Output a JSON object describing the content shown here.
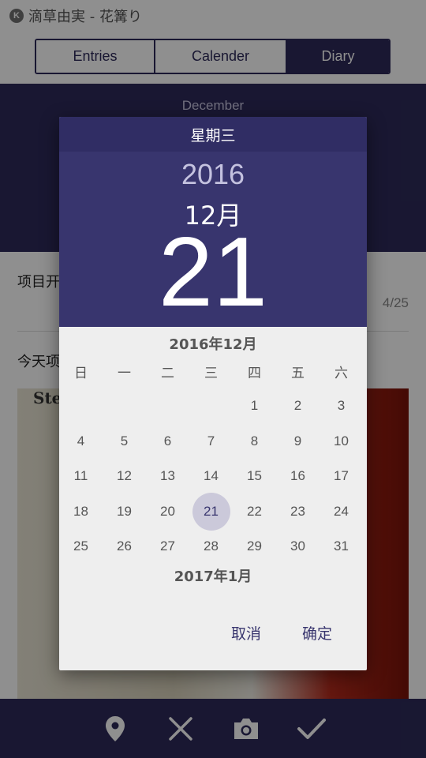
{
  "app": {
    "title": "滴草由実 - 花篝り",
    "logo_letter": "K",
    "tabs": [
      {
        "label": "Entries",
        "active": false
      },
      {
        "label": "Calender",
        "active": false
      },
      {
        "label": "Diary",
        "active": true
      }
    ],
    "hero_month": "December",
    "row1_label": "项目开",
    "row1_count": "4/25",
    "row2_label": "今天项",
    "photo_brand": "Stei",
    "bottom_icons": [
      "location-pin-icon",
      "close-icon",
      "camera-icon",
      "check-icon"
    ]
  },
  "dialog": {
    "weekday": "星期三",
    "year": "2016",
    "month": "12月",
    "day": "21",
    "calendar_title": "2016年12月",
    "weekday_headers": [
      "日",
      "一",
      "二",
      "三",
      "四",
      "五",
      "六"
    ],
    "weeks": [
      [
        "",
        "",
        "",
        "",
        "1",
        "2",
        "3"
      ],
      [
        "4",
        "5",
        "6",
        "7",
        "8",
        "9",
        "10"
      ],
      [
        "11",
        "12",
        "13",
        "14",
        "15",
        "16",
        "17"
      ],
      [
        "18",
        "19",
        "20",
        "21",
        "22",
        "23",
        "24"
      ],
      [
        "25",
        "26",
        "27",
        "28",
        "29",
        "30",
        "31"
      ]
    ],
    "selected_day": "21",
    "next_month_title": "2017年1月",
    "cancel_label": "取消",
    "ok_label": "确定"
  },
  "colors": {
    "primary": "#2d2a5a",
    "dialog_header": "#38356e",
    "selected_circle": "#cbc9da"
  }
}
